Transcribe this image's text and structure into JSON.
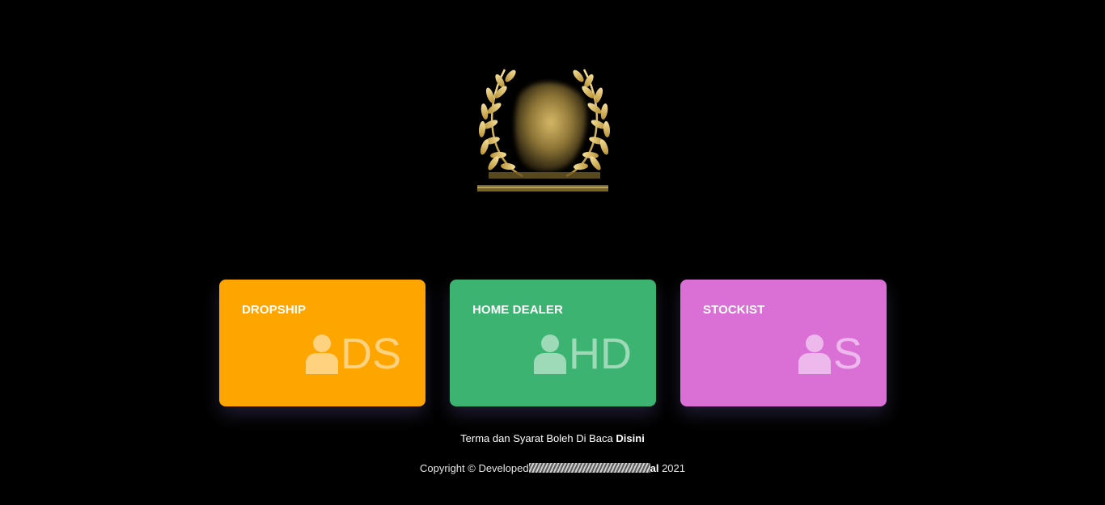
{
  "logo": {
    "icon": "laurel-wreath-crest-logo"
  },
  "cards": [
    {
      "title": "DROPSHIP",
      "abbr": "DS",
      "color": "#FFA500",
      "icon": "user-icon"
    },
    {
      "title": "HOME DEALER",
      "abbr": "HD",
      "color": "#3CB371",
      "icon": "user-icon"
    },
    {
      "title": "STOCKIST",
      "abbr": "S",
      "color": "#DA70D6",
      "icon": "user-icon"
    }
  ],
  "footer": {
    "terms_text": "Terma dan Syarat Boleh Di Baca",
    "terms_link": "Disini",
    "copyright_prefix": "Copyright © Developed",
    "copyright_suffix_bold": "al",
    "copyright_year": "2021"
  }
}
